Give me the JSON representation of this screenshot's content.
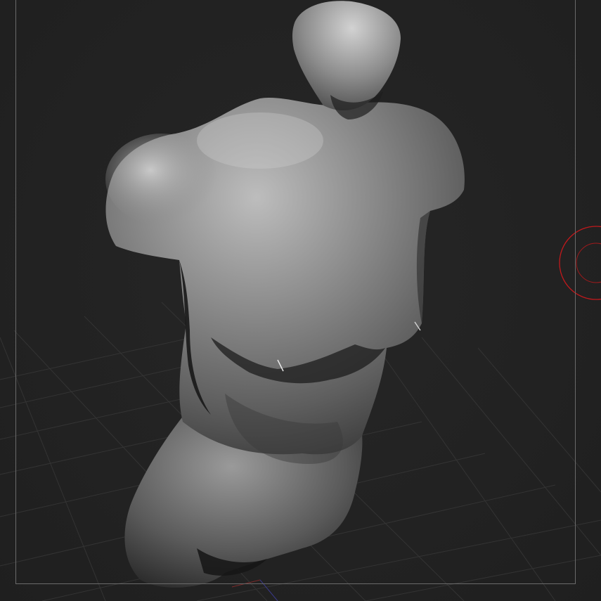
{
  "viewport": {
    "background": "#232323",
    "grid_color": "#3a3a3a",
    "frame_color": "#6a6a6a",
    "cursor_color": "#c0191c"
  },
  "model": {
    "name": "torso-sculpt",
    "base_color": "#8a8a8a",
    "highlight_color": "#d6d6d6",
    "shadow_color": "#1a1a1a"
  },
  "brush_cursor": {
    "icon": "brush-cursor-circle-icon"
  }
}
